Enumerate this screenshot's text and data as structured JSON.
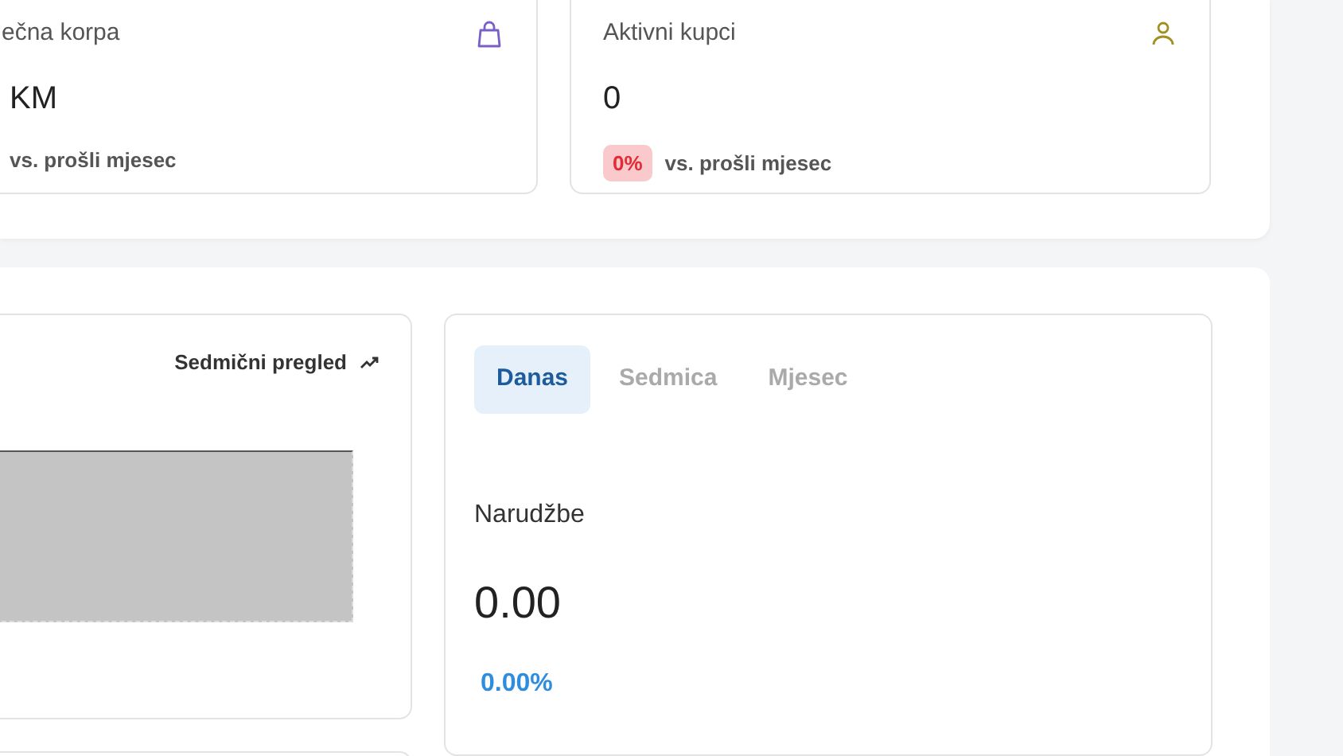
{
  "stat_cards": [
    {
      "title": "ečna korpa",
      "value": "KM",
      "comparison": "vs. prošli mjesec"
    },
    {
      "title": "Aktivni kupci",
      "value": "0",
      "change": "0%",
      "comparison": "vs. prošli mjesec"
    }
  ],
  "weekly_card": {
    "title": "Sedmični pregled"
  },
  "orders_card": {
    "tabs": [
      {
        "label": "Danas",
        "selected": true
      },
      {
        "label": "Sedmica",
        "selected": false
      },
      {
        "label": "Mjesec",
        "selected": false
      }
    ],
    "label": "Narudžbe",
    "value": "0.00",
    "change": "0.00%"
  }
}
